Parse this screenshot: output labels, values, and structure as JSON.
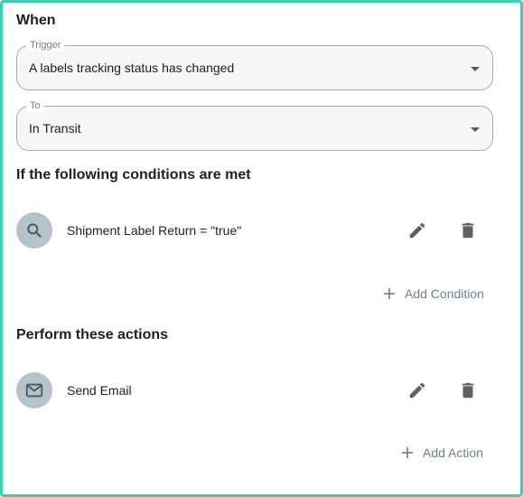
{
  "when": {
    "title": "When",
    "trigger": {
      "legend": "Trigger",
      "value": "A labels tracking status has changed"
    },
    "to": {
      "legend": "To",
      "value": "In Transit"
    }
  },
  "conditions": {
    "title": "If the following conditions are met",
    "items": [
      {
        "label": "Shipment Label Return = \"true\"",
        "icon": "search-icon"
      }
    ],
    "add_label": "Add Condition"
  },
  "actions": {
    "title": "Perform these actions",
    "items": [
      {
        "label": "Send Email",
        "icon": "envelope-icon"
      }
    ],
    "add_label": "Add Action"
  },
  "colors": {
    "frame_border": "#3fcfb0",
    "avatar_bg": "#b4c2c9",
    "add_text": "#6b7f8c",
    "icon_gray": "#616161"
  }
}
